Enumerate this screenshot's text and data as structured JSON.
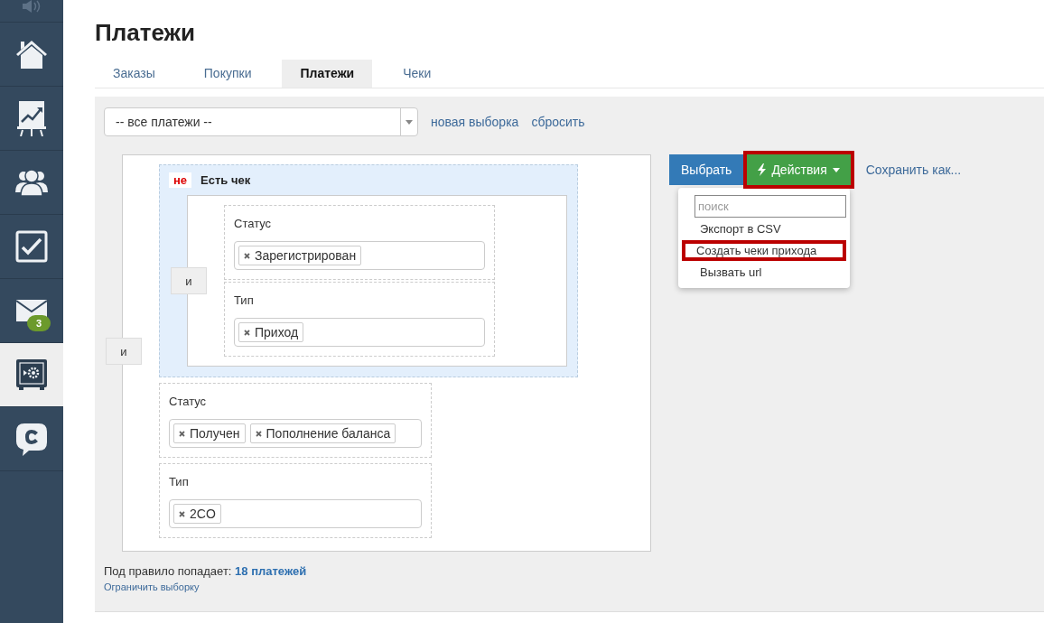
{
  "sidebar": {
    "items": [
      {
        "selected": false
      },
      {
        "selected": false
      },
      {
        "selected": false
      },
      {
        "selected": false
      },
      {
        "selected": false
      },
      {
        "selected": false,
        "badge": "3"
      },
      {
        "selected": true
      },
      {
        "selected": false
      }
    ]
  },
  "title": "Платежи",
  "tabs": [
    {
      "label": "Заказы",
      "selected": false
    },
    {
      "label": "Покупки",
      "selected": false
    },
    {
      "label": "Платежи",
      "selected": true
    },
    {
      "label": "Чеки",
      "selected": false
    }
  ],
  "preset_select": {
    "value": "-- все платежи --"
  },
  "links": [
    "новая выборка",
    "сбросить"
  ],
  "filter": {
    "kind": "group",
    "connector": "и",
    "children": [
      {
        "kind": "group",
        "connector": "и",
        "negation": "не",
        "title": "Есть чек",
        "children": [
          {
            "kind": "condition",
            "label": "Статус",
            "tags": [
              "Зарегистрирован"
            ]
          },
          {
            "kind": "condition",
            "label": "Тип",
            "tags": [
              "Приход"
            ]
          }
        ]
      },
      {
        "kind": "condition",
        "label": "Статус",
        "tags": [
          "Получен",
          "Пополнение баланса"
        ]
      },
      {
        "kind": "condition",
        "label": "Тип",
        "tags": [
          "2CO"
        ]
      }
    ]
  },
  "actions": {
    "select_button": "Выбрать",
    "actions_button": {
      "label": "Действия",
      "highlighted": true
    },
    "save_link": "Сохранить как..."
  },
  "menu": {
    "search": {
      "placeholder": "поиск"
    },
    "items": [
      {
        "label": "Экспорт в CSV",
        "highlighted": false
      },
      {
        "label": "Создать чеки прихода",
        "highlighted": true
      },
      {
        "label": "Вызвать url",
        "highlighted": false
      }
    ]
  },
  "footer": {
    "match_text": "Под правило попадает:",
    "match_link": "18 платежей",
    "limit_link": "Ограничить выборку"
  }
}
